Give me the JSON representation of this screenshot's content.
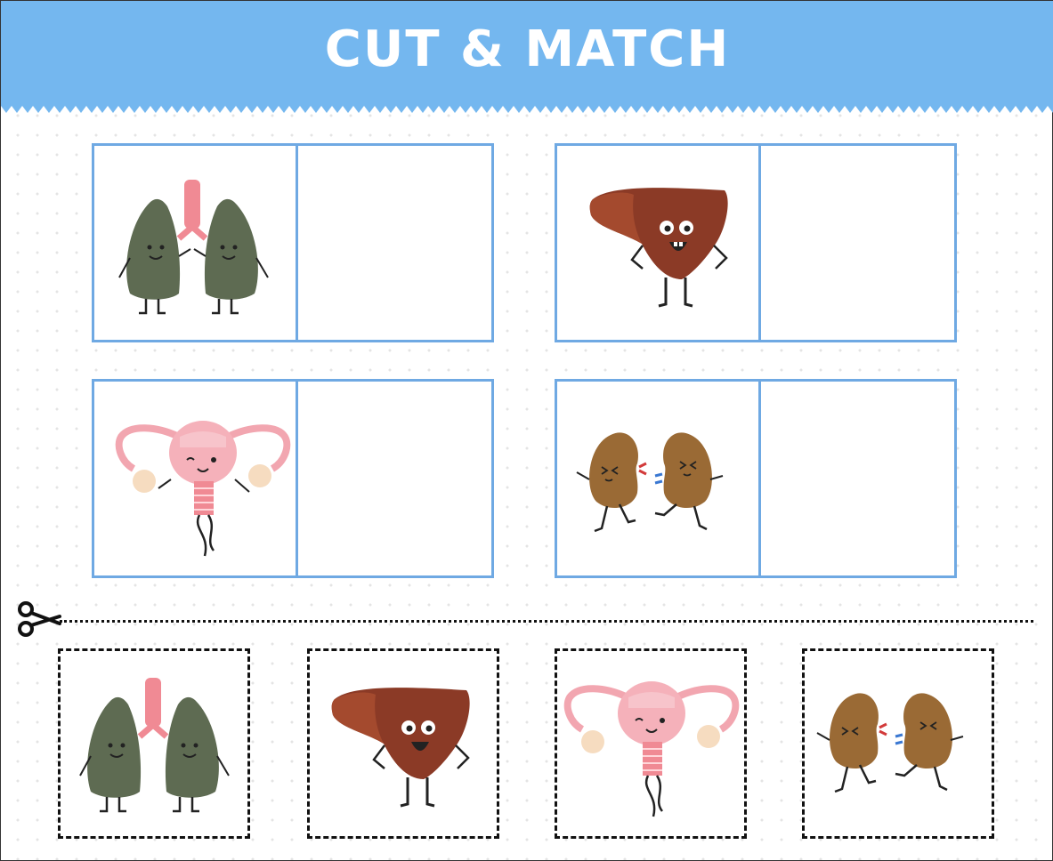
{
  "title": "CUT & MATCH",
  "colors": {
    "header": "#74b7ef",
    "box_border": "#6fa9e3",
    "lungs": "#5e6b52",
    "liver": "#8b3a26",
    "uterus": "#f2a6b0",
    "kidneys": "#9a6a35"
  },
  "match_boxes": [
    {
      "organ": "lungs"
    },
    {
      "organ": "liver"
    },
    {
      "organ": "uterus"
    },
    {
      "organ": "kidneys"
    }
  ],
  "cut_cards": [
    {
      "organ": "lungs"
    },
    {
      "organ": "liver"
    },
    {
      "organ": "uterus"
    },
    {
      "organ": "kidneys"
    }
  ],
  "icons": [
    "scissors-icon"
  ]
}
